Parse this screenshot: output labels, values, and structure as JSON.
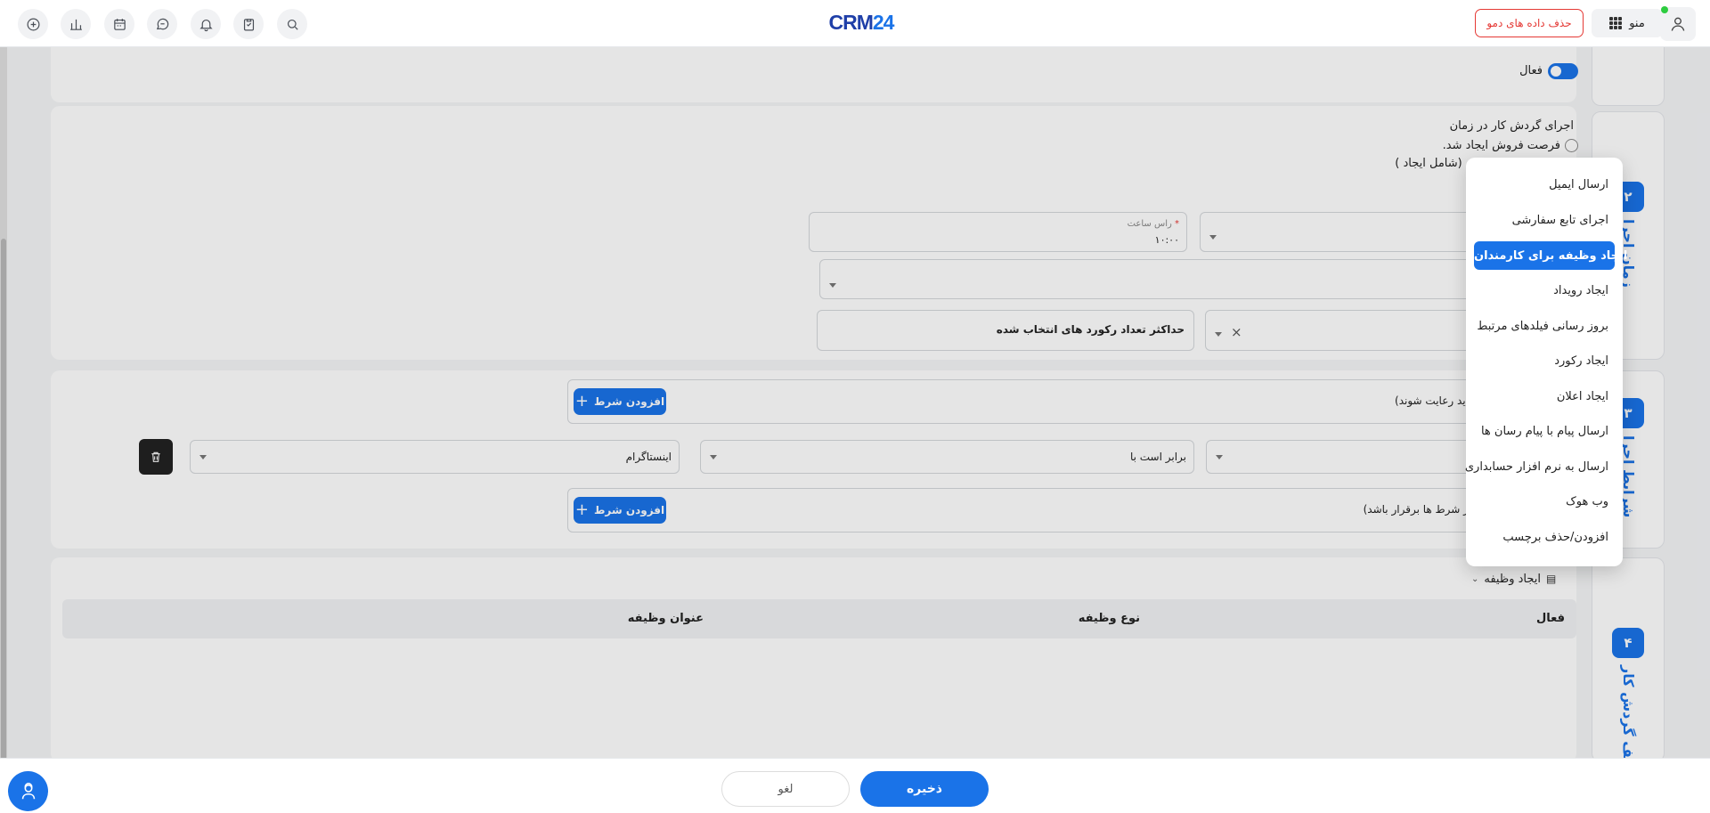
{
  "header": {
    "logo_text_a": "CRM",
    "logo_text_b": "24",
    "demo_delete_label": "حذف داده های دمو",
    "menu_label": "منو"
  },
  "step1": {
    "active_toggle_label": "فعال"
  },
  "step2": {
    "number": "۲",
    "title": "زمان اجرا",
    "run_label": "اجرای گردش کار در زمان",
    "option_created": "فرصت فروش ایجاد شد.",
    "option_updated_partial": "سانی شد (شامل ایجاد )",
    "time_field_label": "راس ساعت",
    "time_field_value": "۱۰:۰۰",
    "max_records_label": "حداکثر تعداد رکورد های انتخاب شده"
  },
  "step3": {
    "number": "۳",
    "title": "شرایط اجرا",
    "all_conditions_hint": "شرط ها باید رعایت شوند)",
    "any_conditions_hint": "اقل یکی از شرط ها برقرار باشد)",
    "add_condition_label": "افزودن شرط",
    "operator_value": "برابر است با",
    "value_value": "اینستاگرام"
  },
  "step4": {
    "number": "۴",
    "title": "وظایف گردش کار",
    "create_task_label": "ایجاد وظیفه",
    "columns": [
      "فعال",
      "نوع وظیفه",
      "عنوان وظیفه"
    ]
  },
  "dropdown": {
    "items": [
      "ارسال ایمیل",
      "اجرای تابع سفارشی",
      "ایجاد وظیفه برای کارمندان",
      "ایجاد رویداد",
      "بروز رسانی فیلدهای مرتبط",
      "ایجاد رکورد",
      "ایجاد اعلان",
      "ارسال پیام با پیام رسان ها",
      "ارسال به نرم افزار حسابداری",
      "وب هوک",
      "افزودن/حذف برچسب"
    ],
    "selected": "ایجاد وظیفه برای کارمندان"
  },
  "footer": {
    "save_label": "ذخیره",
    "cancel_label": "لغو"
  },
  "colors": {
    "accent": "#1a73e8",
    "danger": "#e53935",
    "online": "#2ecc40"
  }
}
